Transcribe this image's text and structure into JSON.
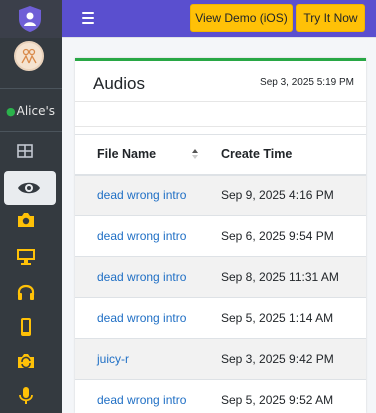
{
  "sidebar": {
    "user_name": "Alice's",
    "nav_icons": [
      "dashboard-icon",
      "eye-icon",
      "camera-icon",
      "desktop-icon",
      "headphones-icon",
      "mobile-icon",
      "camera-rotate-icon",
      "microphone-icon"
    ],
    "active_icon": "eye-icon",
    "accent_color": "#ffc107"
  },
  "topbar": {
    "menu_icon": "hamburger-icon",
    "view_demo_label": "View Demo (iOS)",
    "try_label": "Try It Now",
    "bar_color": "#5a4fcf"
  },
  "card": {
    "title": "Audios",
    "timestamp": "Sep 3, 2025 5:19 PM"
  },
  "table": {
    "columns": [
      "File Name",
      "Create Time"
    ],
    "rows": [
      {
        "file": "dead wrong intro",
        "time": "Sep 9, 2025 4:16 PM"
      },
      {
        "file": "dead wrong intro",
        "time": "Sep 6, 2025 9:54 PM"
      },
      {
        "file": "dead wrong intro",
        "time": "Sep 8, 2025 11:31 AM"
      },
      {
        "file": "dead wrong intro",
        "time": "Sep 5, 2025 1:14 AM"
      },
      {
        "file": "juicy-r",
        "time": "Sep 3, 2025 9:42 PM"
      },
      {
        "file": "dead wrong intro",
        "time": "Sep 5, 2025 9:52 AM"
      }
    ]
  }
}
